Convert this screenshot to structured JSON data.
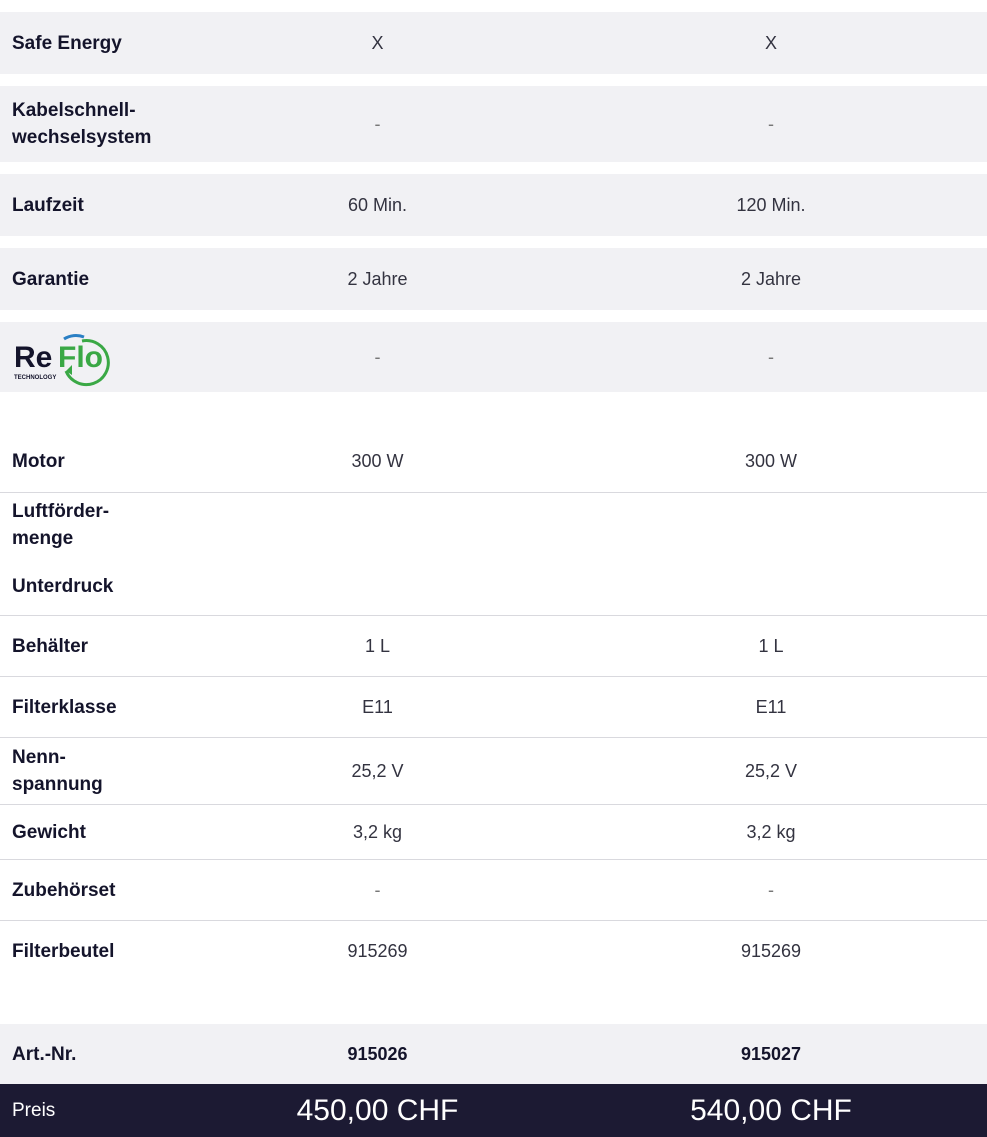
{
  "features": [
    {
      "label": "Safe Energy",
      "col1": "X",
      "col2": "X"
    },
    {
      "label": "Kabelschnell-\nwechselsystem",
      "col1": "-",
      "col2": "-"
    },
    {
      "label": "Laufzeit",
      "col1": "60 Min.",
      "col2": "120 Min."
    },
    {
      "label": "Garantie",
      "col1": "2 Jahre",
      "col2": "2 Jahre"
    }
  ],
  "reflo": {
    "logo_text": "ReFlo",
    "logo_sub": "TECHNOLOGY",
    "col1": "-",
    "col2": "-"
  },
  "specs": [
    {
      "label": "Motor",
      "col1": "300 W",
      "col2": "300 W"
    },
    {
      "label": "Luftförder-\nmenge",
      "col1": "",
      "col2": ""
    },
    {
      "label": "Unterdruck",
      "col1": "",
      "col2": ""
    },
    {
      "label": "Behälter",
      "col1": "1 L",
      "col2": "1 L"
    },
    {
      "label": "Filterklasse",
      "col1": "E11",
      "col2": "E11"
    },
    {
      "label": "Nenn-\nspannung",
      "col1": "25,2 V",
      "col2": "25,2 V"
    },
    {
      "label": "Gewicht",
      "col1": "3,2 kg",
      "col2": "3,2 kg"
    },
    {
      "label": "Zubehörset",
      "col1": "-",
      "col2": "-"
    },
    {
      "label": "Filterbeutel",
      "col1": "915269",
      "col2": "915269"
    }
  ],
  "article": {
    "label": "Art.-Nr.",
    "col1": "915026",
    "col2": "915027"
  },
  "price": {
    "label": "Preis",
    "col1": "450,00 CHF",
    "col2": "540,00 CHF"
  },
  "colors": {
    "price_bar": "#1c1a33",
    "row_shade": "#f1f1f4",
    "reflo_green": "#3aa845",
    "reflo_blue": "#2a7fc4"
  }
}
